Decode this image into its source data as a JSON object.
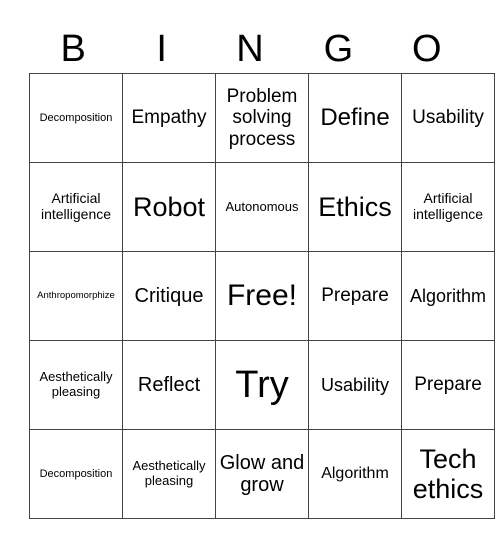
{
  "header": [
    "B",
    "I",
    "N",
    "G",
    "O"
  ],
  "grid": [
    [
      "Decomposition",
      "Empathy",
      "Problem solving process",
      "Define",
      "Usability"
    ],
    [
      "Artificial intelligence",
      "Robot",
      "Autonomous",
      "Ethics",
      "Artificial intelligence"
    ],
    [
      "Anthropomorphize",
      "Critique",
      "Free!",
      "Prepare",
      "Algorithm"
    ],
    [
      "Aesthetically pleasing",
      "Reflect",
      "Try",
      "Usability",
      "Prepare"
    ],
    [
      "Decomposition",
      "Aesthetically pleasing",
      "Glow and grow",
      "Algorithm",
      "Tech ethics"
    ]
  ]
}
